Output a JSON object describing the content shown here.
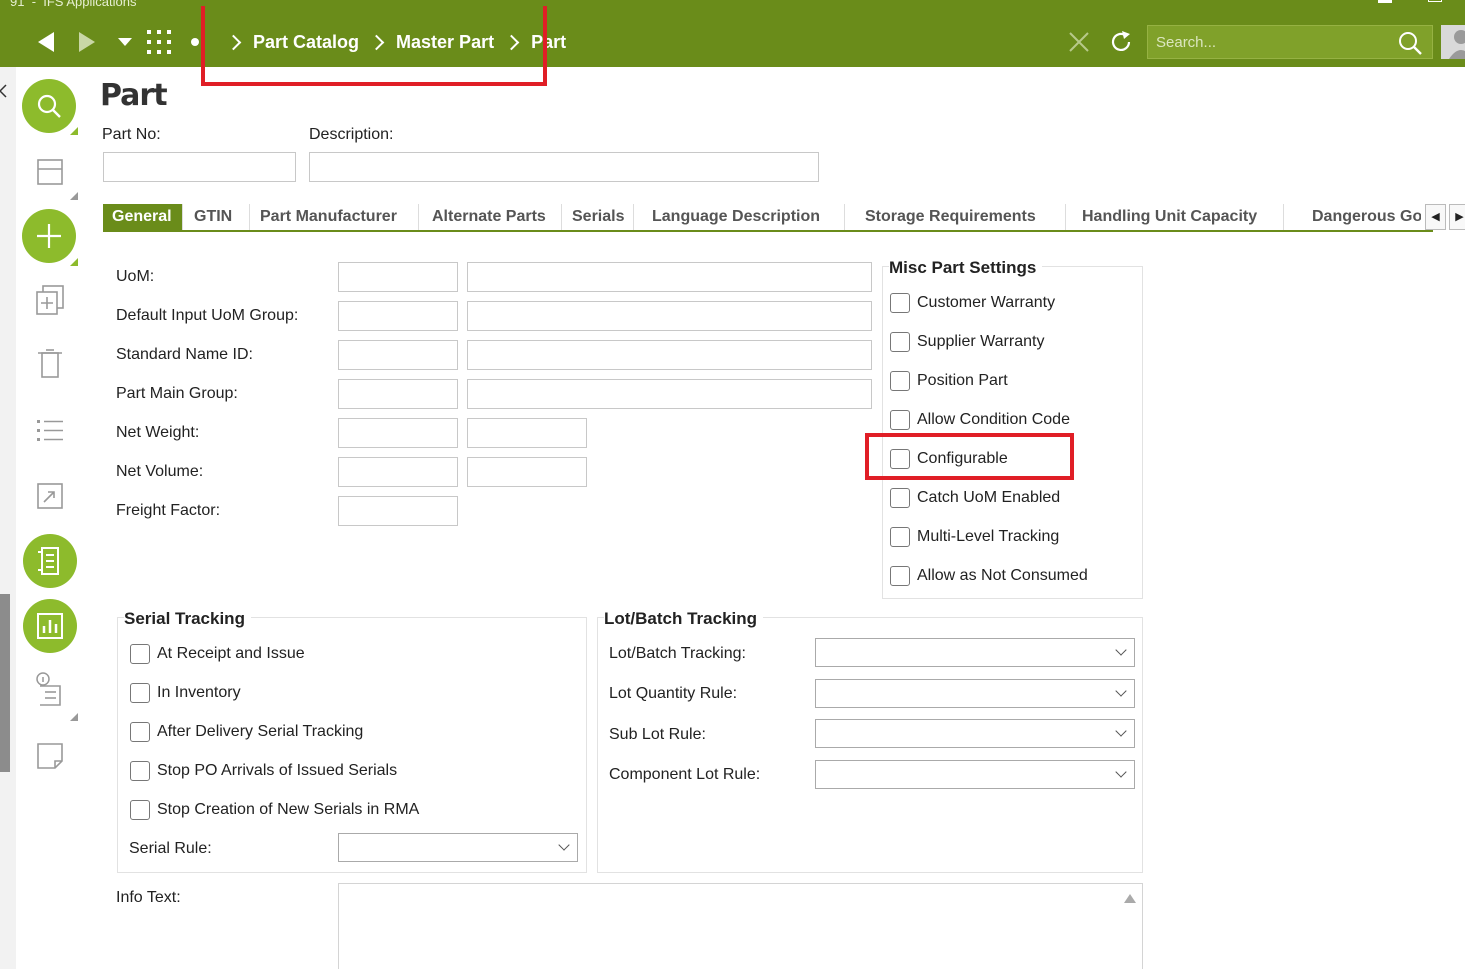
{
  "app": {
    "title": "IFS Applications",
    "title_prefix": "91"
  },
  "topbar": {
    "breadcrumbs": [
      "Part Catalog",
      "Master Part",
      "Part"
    ],
    "search": {
      "placeholder": "Search..."
    }
  },
  "page": {
    "title": "Part",
    "part_no": {
      "label": "Part No:",
      "value": ""
    },
    "description": {
      "label": "Description:",
      "value": ""
    }
  },
  "tabs": [
    "General",
    "GTIN",
    "Part Manufacturer",
    "Alternate Parts",
    "Serials",
    "Language Description",
    "Storage Requirements",
    "Handling Unit Capacity",
    "Dangerous Go"
  ],
  "general": {
    "fields": [
      "UoM:",
      "Default Input UoM Group:",
      "Standard Name ID:",
      "Part Main Group:",
      "Net Weight:",
      "Net Volume:",
      "Freight Factor:"
    ]
  },
  "misc_settings": {
    "title": "Misc Part Settings",
    "items": [
      "Customer Warranty",
      "Supplier Warranty",
      "Position Part",
      "Allow Condition Code",
      "Configurable",
      "Catch UoM Enabled",
      "Multi-Level Tracking",
      "Allow as Not Consumed"
    ]
  },
  "serial_tracking": {
    "title": "Serial Tracking",
    "items": [
      "At Receipt and Issue",
      "In Inventory",
      "After Delivery Serial Tracking",
      "Stop PO Arrivals of Issued Serials",
      "Stop Creation of New Serials in RMA"
    ],
    "serial_rule_label": "Serial Rule:"
  },
  "lot_batch": {
    "title": "Lot/Batch Tracking",
    "fields": [
      "Lot/Batch Tracking:",
      "Lot Quantity Rule:",
      "Sub Lot Rule:",
      "Component Lot Rule:"
    ]
  },
  "info_text": {
    "label": "Info Text:"
  },
  "colors": {
    "brand_green": "#6a8c1a",
    "accent_green": "#8dbb2c",
    "highlight_red": "#e01e26"
  },
  "icons": [
    "back-icon",
    "forward-icon",
    "dropdown-icon",
    "apps-grid-icon",
    "close-icon",
    "refresh-icon",
    "search-icon"
  ]
}
